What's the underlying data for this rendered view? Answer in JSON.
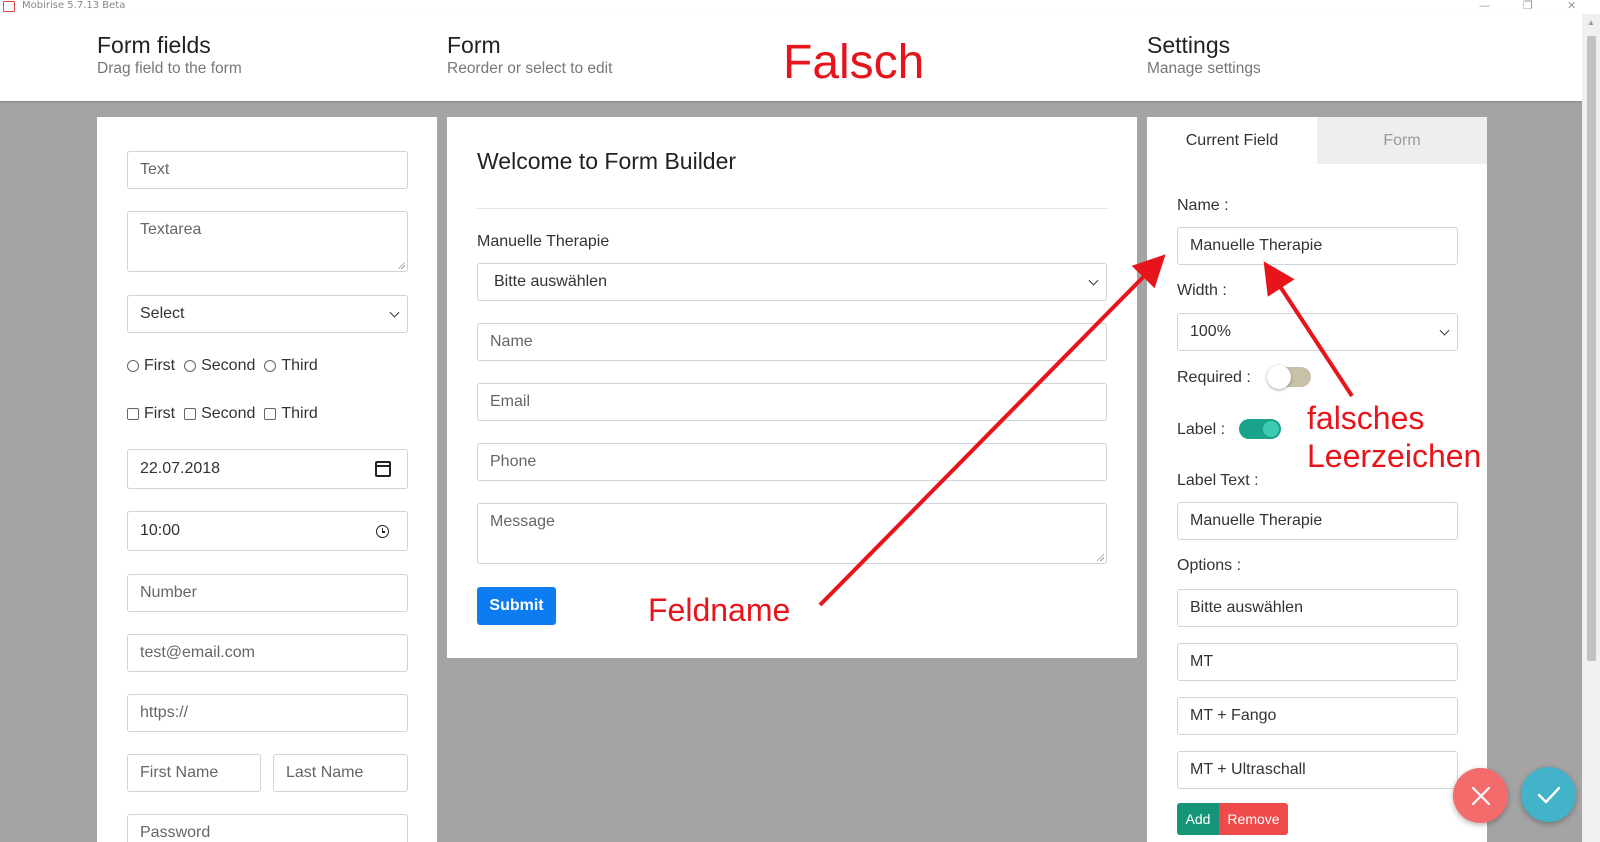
{
  "window": {
    "title": "Mobirise 5.7.13 Beta",
    "controls": [
      "—",
      "❐",
      "✕"
    ]
  },
  "header": {
    "form_fields": {
      "title": "Form fields",
      "subtitle": "Drag field to the form"
    },
    "form": {
      "title": "Form",
      "subtitle": "Reorder or select to edit"
    },
    "settings": {
      "title": "Settings",
      "subtitle": "Manage settings"
    }
  },
  "fields_panel": {
    "text": "Text",
    "textarea": "Textarea",
    "select": "Select",
    "radios": [
      "First",
      "Second",
      "Third"
    ],
    "checkboxes": [
      "First",
      "Second",
      "Third"
    ],
    "date": "22.07.2018",
    "time": "10:00",
    "number": "Number",
    "email": "test@email.com",
    "url": "https://",
    "first_name": "First Name",
    "last_name": "Last Name",
    "password": "Password"
  },
  "form_panel": {
    "title": "Welcome to Form Builder",
    "field_label": "Manuelle Therapie",
    "select_value": "Bitte auswählen",
    "name": "Name",
    "email": "Email",
    "phone": "Phone",
    "message": "Message",
    "submit": "Submit"
  },
  "settings_panel": {
    "tabs": {
      "current": "Current Field",
      "form": "Form"
    },
    "name_label": "Name :",
    "name_value": "Manuelle Therapie",
    "width_label": "Width :",
    "width_value": "100%",
    "required_label": "Required :",
    "required_on": false,
    "label_label": "Label :",
    "label_on": true,
    "label_text_label": "Label Text :",
    "label_text_value": "Manuelle Therapie",
    "options_label": "Options :",
    "options": [
      "Bitte auswählen",
      "MT",
      "MT + Fango",
      "MT + Ultraschall"
    ],
    "add": "Add",
    "remove": "Remove"
  },
  "annotations": {
    "falsch": "Falsch",
    "feldname": "Feldname",
    "falsches_line1": "falsches",
    "falsches_line2": "Leerzeichen",
    "color": "#e8141b"
  }
}
